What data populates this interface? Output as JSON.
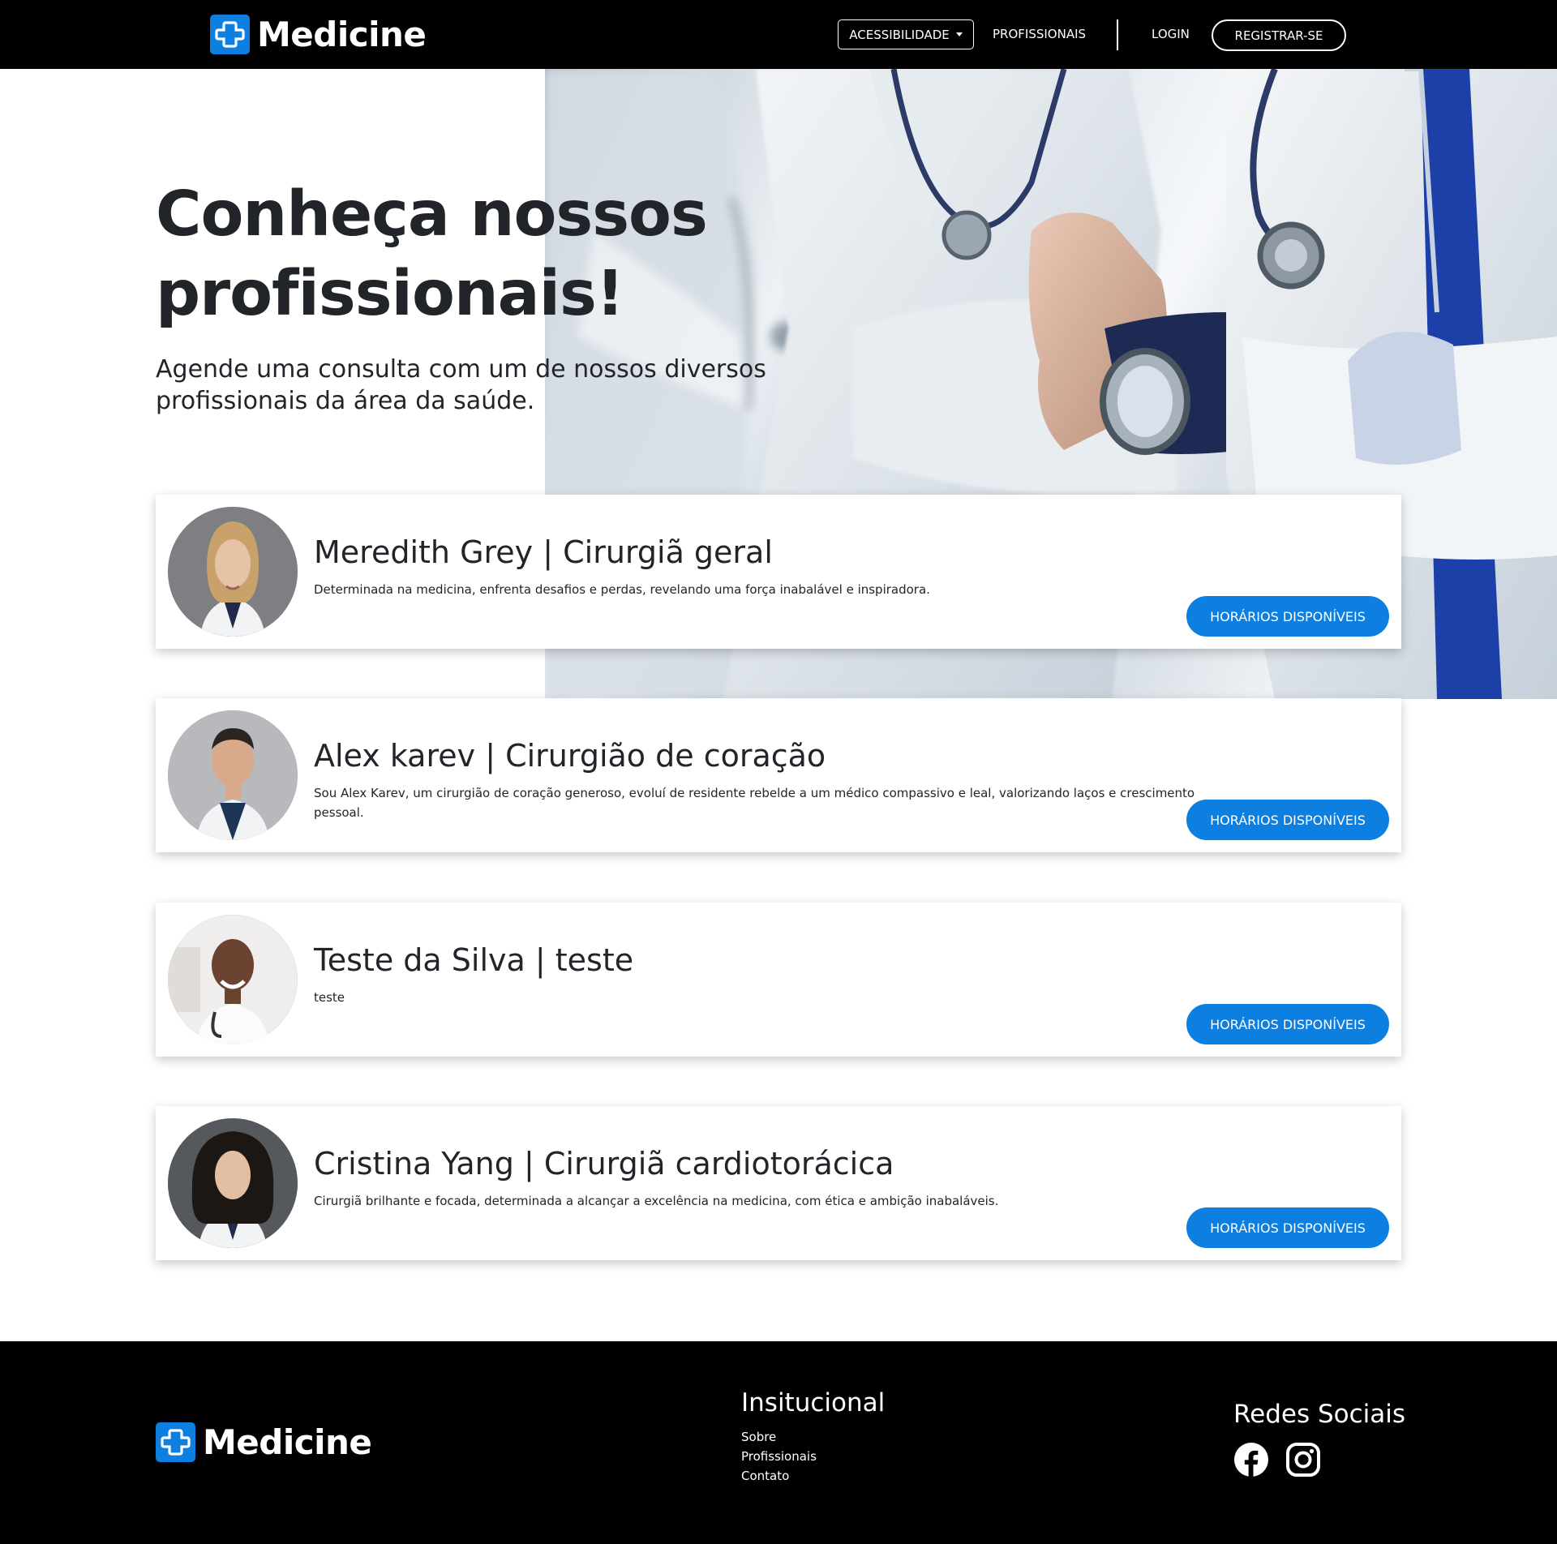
{
  "navbar": {
    "brand": "Medicine",
    "accessibility_label": "ACESSIBILIDADE",
    "professionals_label": "PROFISSIONAIS",
    "login_label": "LOGIN",
    "register_label": "REGISTRAR-SE"
  },
  "hero": {
    "title": "Conheça nossos profissionais!",
    "subtitle": "Agende uma consulta com um de nossos diversos profissionais da área da saúde."
  },
  "professionals": [
    {
      "name": "Meredith Grey | Cirurgiã geral",
      "description": "Determinada na medicina, enfrenta desafios e perdas, revelando uma força inabalável e inspiradora.",
      "button_label": "HORÁRIOS DISPONÍVEIS"
    },
    {
      "name": "Alex karev | Cirurgião de coração",
      "description": "Sou Alex Karev, um cirurgião de coração generoso, evoluí de residente rebelde a um médico compassivo e leal, valorizando laços e crescimento pessoal.",
      "button_label": "HORÁRIOS DISPONÍVEIS"
    },
    {
      "name": "Teste da Silva | teste",
      "description": "teste",
      "button_label": "HORÁRIOS DISPONÍVEIS"
    },
    {
      "name": "Cristina Yang | Cirurgiã cardiotorácica",
      "description": "Cirurgiã brilhante e focada, determinada a alcançar a excelência na medicina, com ética e ambição inabaláveis.",
      "button_label": "HORÁRIOS DISPONÍVEIS"
    }
  ],
  "footer": {
    "brand": "Medicine",
    "institutional_title": "Insitucional",
    "links": [
      "Sobre",
      "Profissionais",
      "Contato"
    ],
    "social_title": "Redes Sociais",
    "social_icons": [
      "facebook-icon",
      "instagram-icon"
    ]
  },
  "colors": {
    "accent": "#0d7fe0",
    "navbar_bg": "#000000",
    "footer_bg": "#000000",
    "text": "#212529"
  }
}
